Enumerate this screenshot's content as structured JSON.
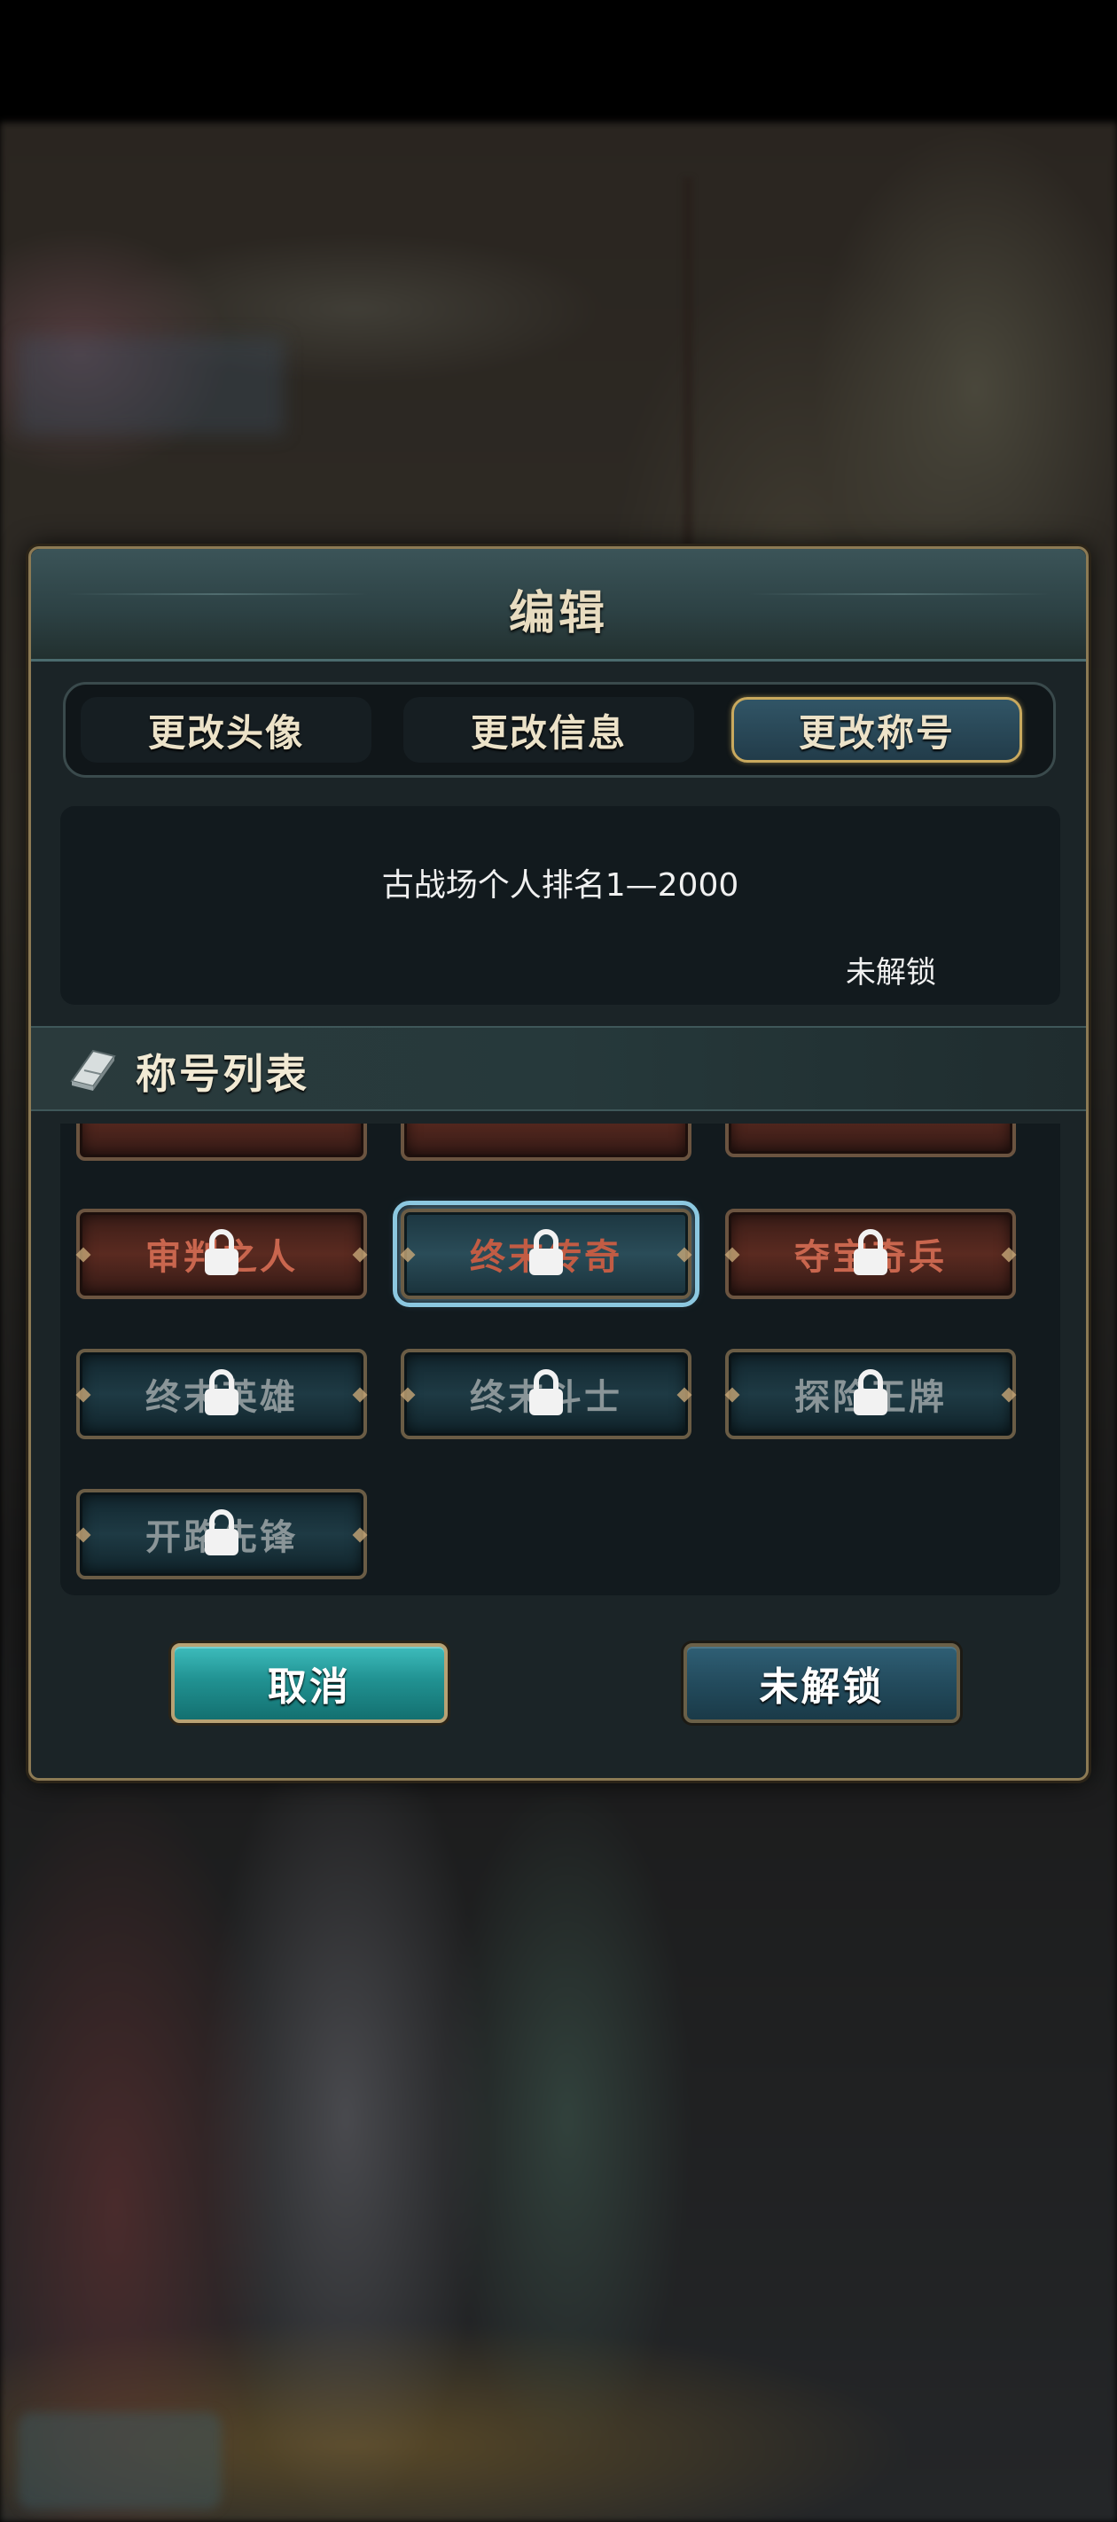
{
  "dialog": {
    "title": "编辑",
    "tabs": [
      {
        "label": "更改头像",
        "active": false
      },
      {
        "label": "更改信息",
        "active": false
      },
      {
        "label": "更改称号",
        "active": true
      }
    ],
    "info": {
      "description": "古战场个人排名1—2000",
      "status": "未解锁"
    },
    "section_title": "称号列表",
    "titles": [
      {
        "label": "审判之人",
        "style": "red",
        "locked": true,
        "selected": false
      },
      {
        "label": "终末传奇",
        "style": "blue",
        "locked": true,
        "selected": true
      },
      {
        "label": "夺宝奇兵",
        "style": "red",
        "locked": true,
        "selected": false
      },
      {
        "label": "终末英雄",
        "style": "teal",
        "locked": true,
        "selected": false
      },
      {
        "label": "终末斗士",
        "style": "teal",
        "locked": true,
        "selected": false
      },
      {
        "label": "探险王牌",
        "style": "teal",
        "locked": true,
        "selected": false
      },
      {
        "label": "开路先锋",
        "style": "teal",
        "locked": true,
        "selected": false
      }
    ],
    "buttons": {
      "cancel": "取消",
      "confirm": "未解锁"
    }
  },
  "colors": {
    "accent_gold": "#c9a95e",
    "cancel_teal": "#219292",
    "selected_outline": "#8cc8e0"
  },
  "icons": {
    "section": "book-icon",
    "locked": "lock-icon"
  }
}
